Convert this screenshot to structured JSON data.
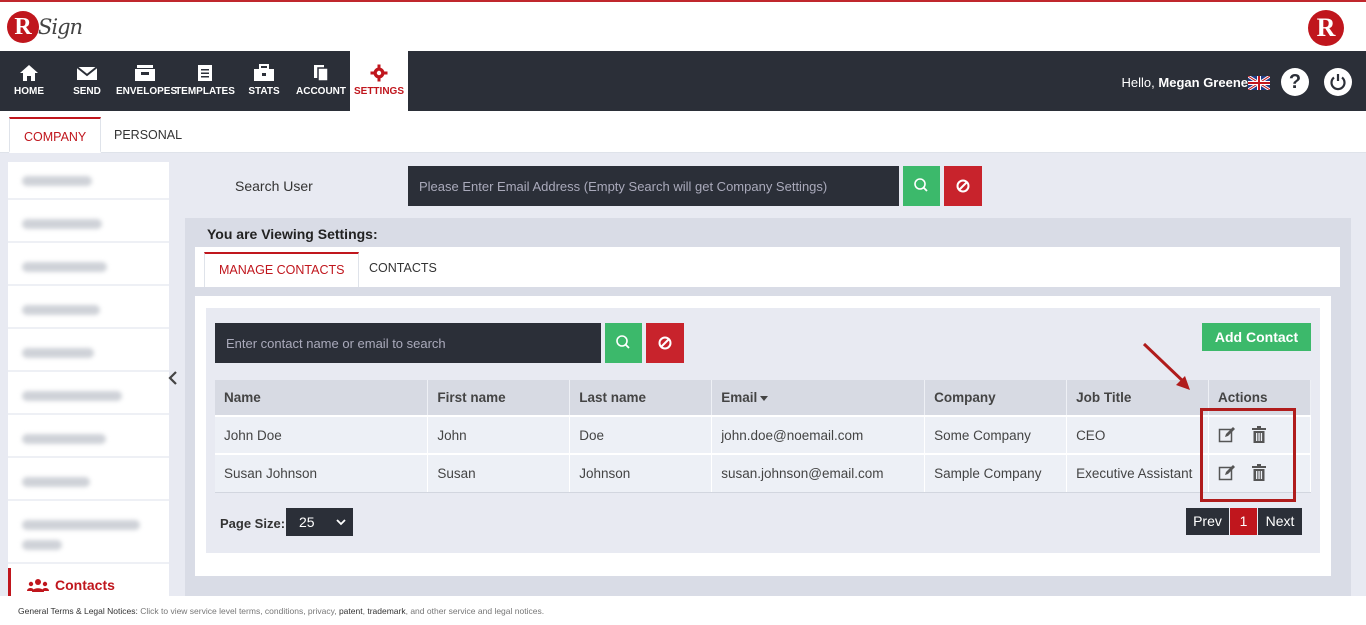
{
  "brand": {
    "logo_letter": "R",
    "logo_word": "Sign",
    "right_letter": "R"
  },
  "nav": {
    "items": [
      {
        "label": "HOME",
        "icon": "home-icon"
      },
      {
        "label": "SEND",
        "icon": "envelope-icon"
      },
      {
        "label": "ENVELOPES",
        "icon": "envelopes-icon"
      },
      {
        "label": "TEMPLATES",
        "icon": "templates-icon"
      },
      {
        "label": "STATS",
        "icon": "briefcase-icon"
      },
      {
        "label": "ACCOUNT",
        "icon": "account-icon"
      },
      {
        "label": "SETTINGS",
        "icon": "gear-icon"
      }
    ],
    "greeting": "Hello,",
    "user_name": "Megan Greene",
    "help_symbol": "?"
  },
  "settings_tabs": {
    "company": "COMPANY",
    "personal": "PERSONAL"
  },
  "sidebar": {
    "contacts_label": "Contacts"
  },
  "search_user": {
    "label": "Search User",
    "placeholder": "Please Enter Email Address (Empty Search will get Company Settings)"
  },
  "viewing": {
    "label": "You are Viewing Settings:"
  },
  "inner_tabs": {
    "manage_contacts": "MANAGE CONTACTS",
    "contacts": "CONTACTS"
  },
  "contacts": {
    "search_placeholder": "Enter contact name or email to search",
    "add_button": "Add Contact",
    "columns": [
      "Name",
      "First name",
      "Last name",
      "Email",
      "Company",
      "Job Title",
      "Actions"
    ],
    "rows": [
      {
        "name": "John Doe",
        "first": "John",
        "last": "Doe",
        "email": "john.doe@noemail.com",
        "company": "Some Company",
        "job": "CEO"
      },
      {
        "name": "Susan Johnson",
        "first": "Susan",
        "last": "Johnson",
        "email": "susan.johnson@email.com",
        "company": "Sample Company",
        "job": "Executive Assistant"
      }
    ]
  },
  "pagination": {
    "page_size_label": "Page Size:",
    "page_size": "25",
    "prev": "Prev",
    "current": "1",
    "next": "Next"
  },
  "footer": {
    "prefix": "General Terms & Legal Notices:",
    "text1": "Click to view service level terms, conditions, privacy,",
    "patent": "patent",
    "comma": ",",
    "trademark": "trademark",
    "text2": ", and other service and legal notices."
  },
  "colors": {
    "brand_red": "#c0161d",
    "nav_dark": "#2b2f38",
    "success_green": "#3cb96b"
  }
}
